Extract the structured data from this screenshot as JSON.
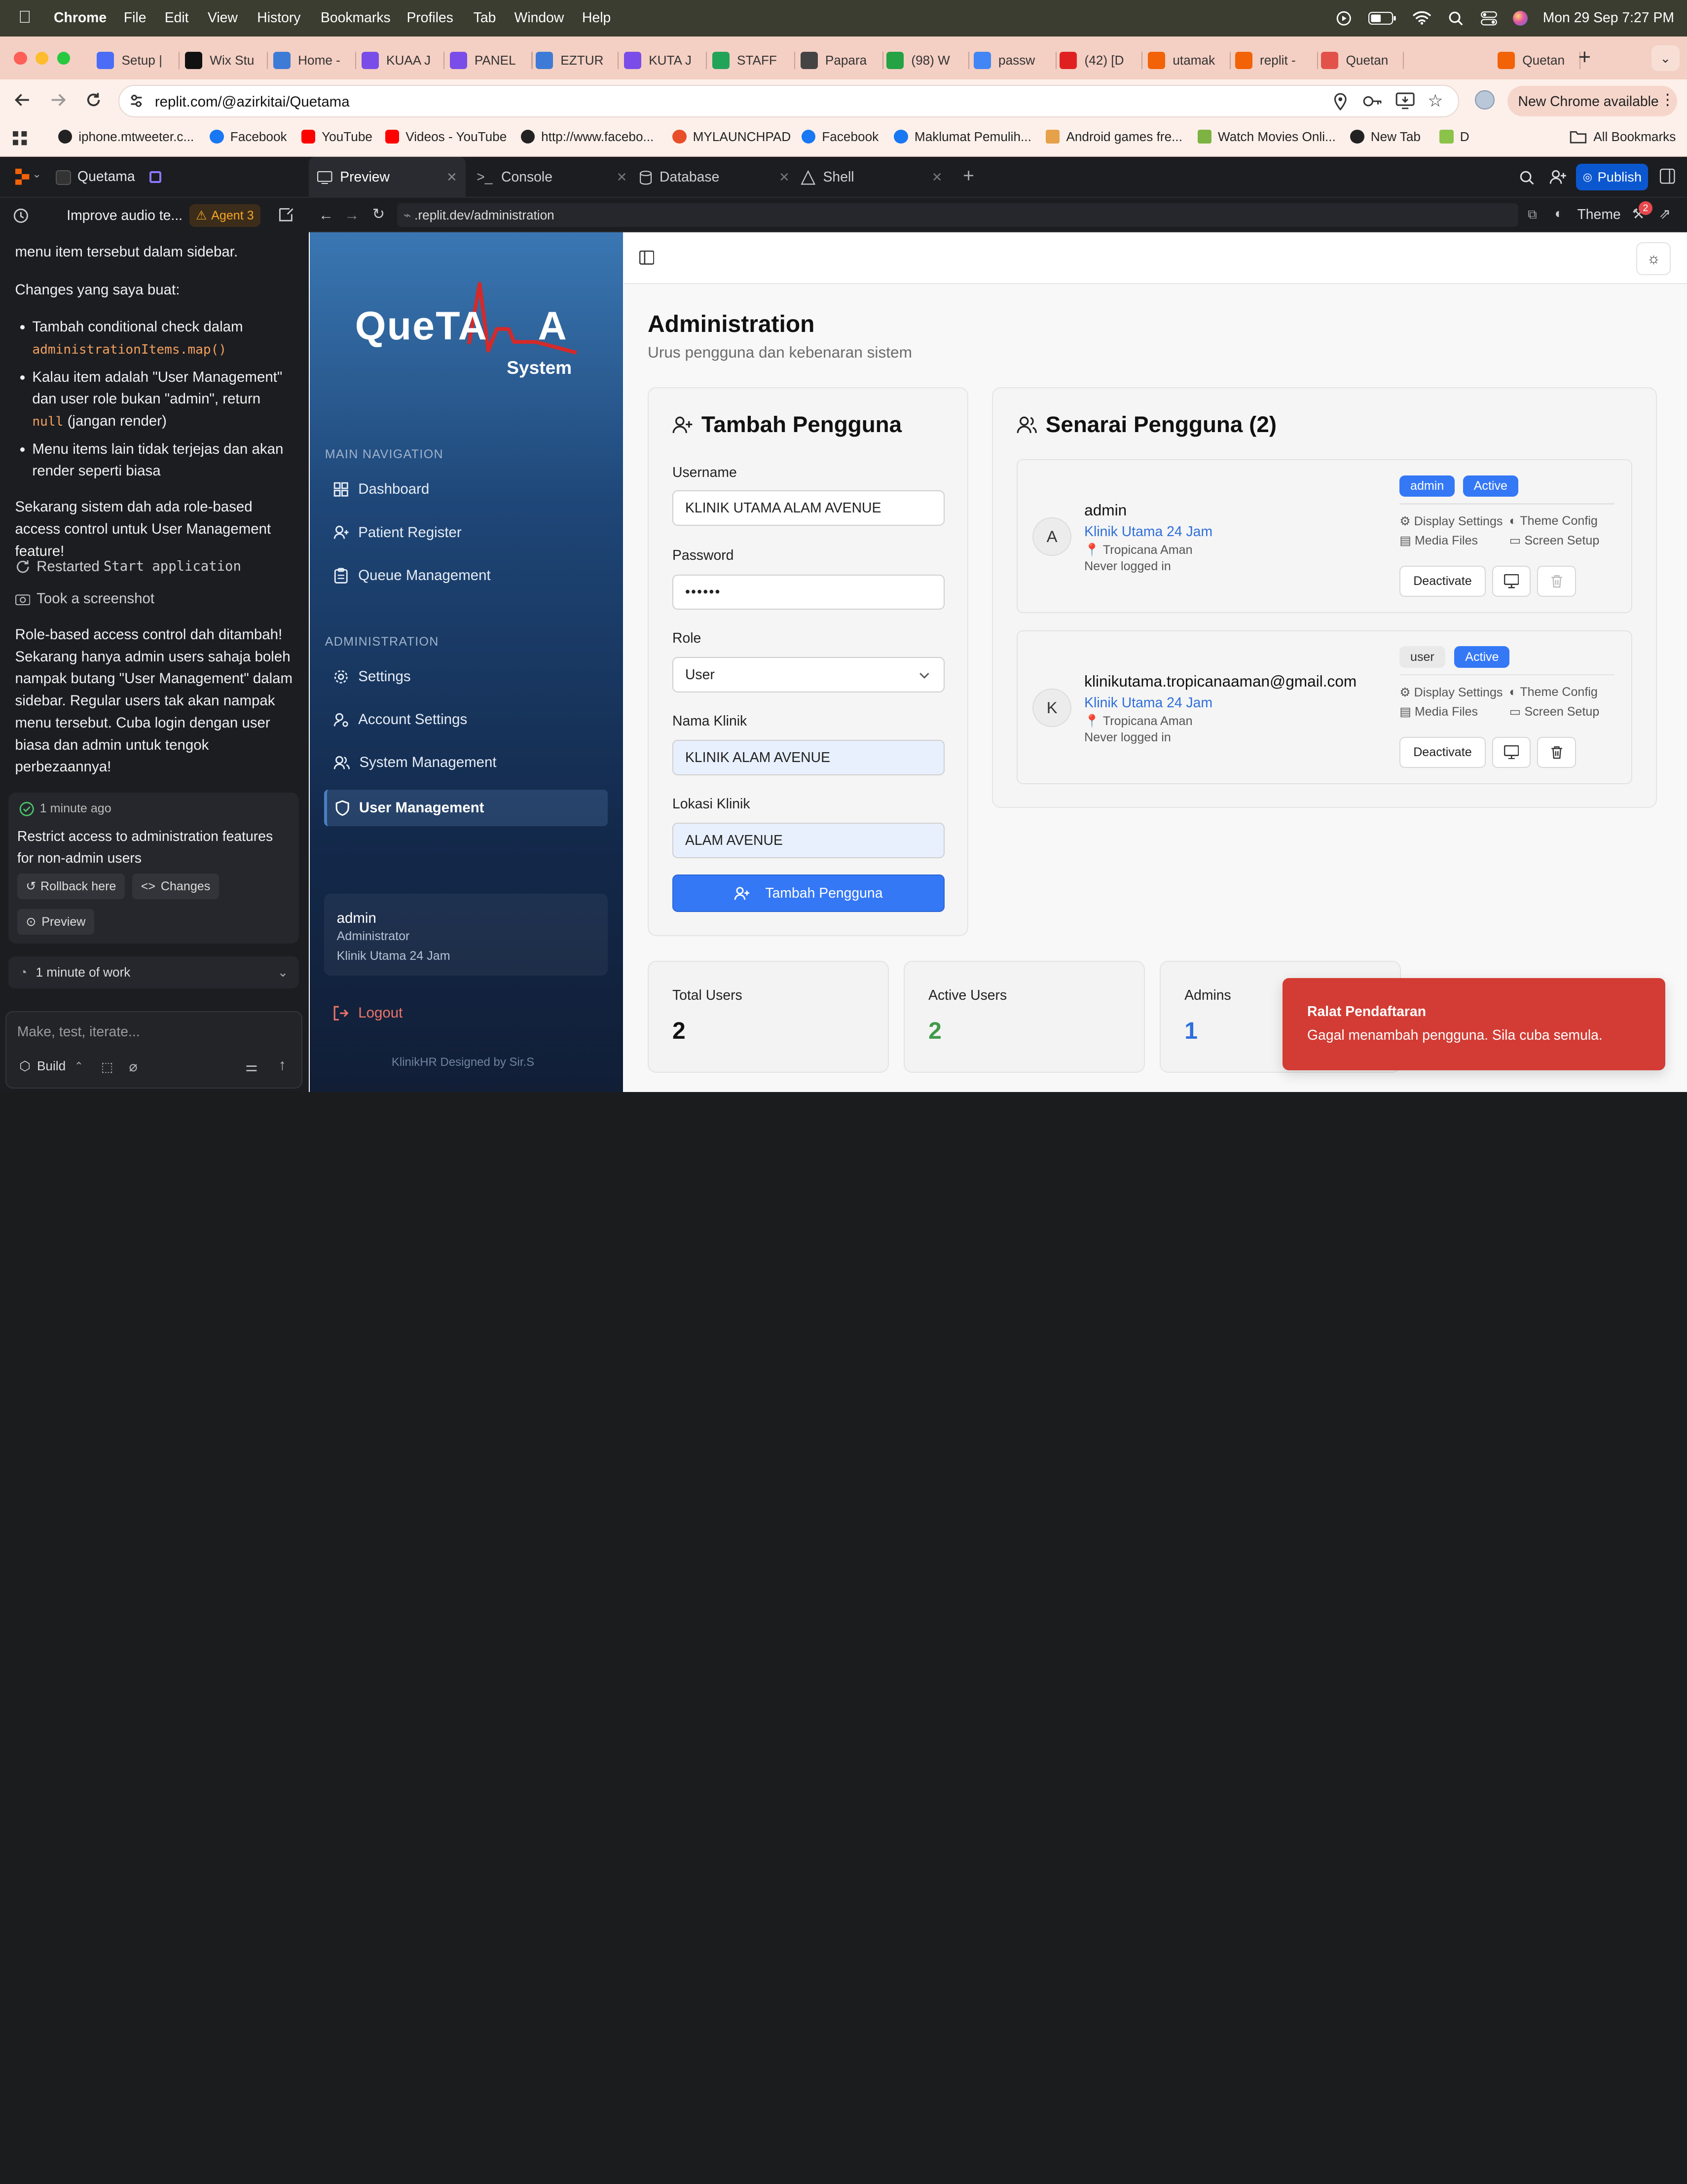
{
  "menubar": {
    "app": "Chrome",
    "items": [
      "File",
      "Edit",
      "View",
      "History",
      "Bookmarks",
      "Profiles",
      "Tab",
      "Window",
      "Help"
    ],
    "datetime": "Mon 29 Sep  7:27 PM"
  },
  "tabs": [
    "Setup |",
    "Wix Stu",
    "Home -",
    "KUAA J",
    "PANEL",
    "EZTUR",
    "KUTA J",
    "STAFF",
    "Papara",
    "(98) W",
    "passw",
    "(42) [D",
    "utamak",
    "replit -",
    "Quetan",
    "Qu",
    "Quetan"
  ],
  "address": {
    "url": "replit.com/@azirkitai/Quetama",
    "update_label": "New Chrome available"
  },
  "bookmarks": [
    "iphone.mtweeter.c...",
    "Facebook",
    "YouTube",
    "Videos - YouTube",
    "http://www.facebo...",
    "MYLAUNCHPAD",
    "Facebook",
    "Maklumat Pemulih...",
    "Android games fre...",
    "Watch Movies Onli...",
    "New Tab",
    "D",
    "All Bookmarks"
  ],
  "replit": {
    "project": "Quetama",
    "panel_tabs": [
      "Preview",
      "Console",
      "Database",
      "Shell"
    ],
    "publish": "Publish",
    "theme": "Theme",
    "notif_count": "2",
    "preview_url": ".replit.dev/administration",
    "thread_title": "Improve audio te...",
    "agent": "Agent 3"
  },
  "chat": {
    "intro": "menu item tersebut dalam sidebar.",
    "changes_title": "Changes yang saya buat:",
    "b1a": "Tambah conditional check dalam",
    "b1code": "administrationItems.map()",
    "b2a": "Kalau item adalah \"User Management\" dan user role bukan \"admin\", return",
    "b2code": "null",
    "b2b": "(jangan render)",
    "b3": "Menu items lain tidak terjejas dan akan render seperti biasa",
    "summary": "Sekarang sistem dah ada role-based access control untuk User Management feature!",
    "act1a": "Restarted",
    "act1b": "Start application",
    "act2": "Took a screenshot",
    "final": "Role-based access control dah ditambah! Sekarang hanya admin users sahaja boleh nampak butang \"User Management\" dalam sidebar. Regular users tak akan nampak menu tersebut. Cuba login dengan user biasa dan admin untuk tengok perbezaannya!",
    "checkpoint_time": "1 minute ago",
    "checkpoint_title": "Restrict access to administration features for non-admin users",
    "rollback": "Rollback here",
    "changes": "Changes",
    "preview": "Preview",
    "work": "1 minute of work",
    "input_placeholder": "Make, test, iterate...",
    "build": "Build"
  },
  "app": {
    "logo_a": "QueTA",
    "logo_b": "A",
    "logo_sub": "System",
    "main_nav_label": "MAIN NAVIGATION",
    "main_nav": [
      "Dashboard",
      "Patient Register",
      "Queue Management"
    ],
    "admin_nav_label": "ADMINISTRATION",
    "admin_nav": [
      "Settings",
      "Account Settings",
      "System Management",
      "User Management"
    ],
    "user_name": "admin",
    "user_role": "Administrator",
    "user_clinic": "Klinik Utama 24 Jam",
    "logout": "Logout",
    "footer": "KlinikHR Designed by Sir.S",
    "page_title": "Administration",
    "page_subtitle": "Urus pengguna dan kebenaran sistem",
    "form": {
      "title": "Tambah Pengguna",
      "username_label": "Username",
      "username": "KLINIK UTAMA ALAM AVENUE",
      "password_label": "Password",
      "password": "••••••",
      "role_label": "Role",
      "role": "User",
      "clinic_label": "Nama Klinik",
      "clinic": "KLINIK ALAM AVENUE",
      "loc_label": "Lokasi Klinik",
      "loc": "ALAM AVENUE",
      "submit": "Tambah Pengguna"
    },
    "list_title": "Senarai Pengguna (2)",
    "users": [
      {
        "initial": "A",
        "name": "admin",
        "clinic": "Klinik Utama 24 Jam",
        "location": "Tropicana Aman",
        "login": "Never logged in",
        "role": "admin",
        "status": "Active"
      },
      {
        "initial": "K",
        "name": "klinikutama.tropicanaaman@gmail.com",
        "clinic": "Klinik Utama 24 Jam",
        "location": "Tropicana Aman",
        "login": "Never logged in",
        "role": "user",
        "status": "Active"
      }
    ],
    "perms": [
      "Display Settings",
      "Theme Config",
      "Media Files",
      "Screen Setup"
    ],
    "deactivate": "Deactivate",
    "stats": [
      {
        "label": "Total Users",
        "value": "2"
      },
      {
        "label": "Active Users",
        "value": "2"
      },
      {
        "label": "Admins",
        "value": "1"
      }
    ],
    "toast_title": "Ralat Pendaftaran",
    "toast_msg": "Gagal menambah pengguna. Sila cuba semula."
  },
  "colors": {
    "accent": "#3478f6",
    "publish": "#0b57d0",
    "toast": "#d33c34",
    "green": "#3f9a4a"
  }
}
